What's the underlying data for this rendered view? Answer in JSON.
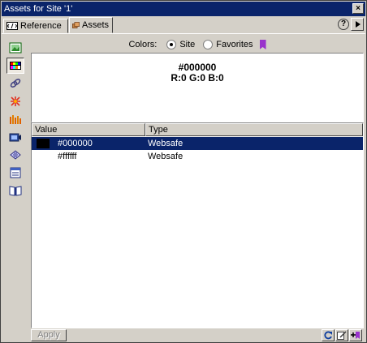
{
  "window": {
    "title": "Assets for Site '1'",
    "close_label": "×"
  },
  "tabs": [
    {
      "label": "Reference",
      "icon": "reference-icon"
    },
    {
      "label": "Assets",
      "icon": "assets-icon",
      "active": true
    }
  ],
  "header": {
    "help_label": "?"
  },
  "sidebar": {
    "items": [
      {
        "name": "images",
        "icon": "image-icon"
      },
      {
        "name": "colors",
        "icon": "color-swatch-icon",
        "selected": true
      },
      {
        "name": "urls",
        "icon": "link-icon"
      },
      {
        "name": "flash",
        "icon": "flash-icon"
      },
      {
        "name": "shockwave",
        "icon": "shockwave-icon"
      },
      {
        "name": "movies",
        "icon": "movie-icon"
      },
      {
        "name": "scripts",
        "icon": "script-icon"
      },
      {
        "name": "templates",
        "icon": "template-icon"
      },
      {
        "name": "library",
        "icon": "library-icon"
      }
    ]
  },
  "colors_filter": {
    "label": "Colors:",
    "options": [
      {
        "label": "Site",
        "selected": true
      },
      {
        "label": "Favorites",
        "selected": false
      }
    ]
  },
  "preview": {
    "hex": "#000000",
    "rgb": "R:0 G:0 B:0"
  },
  "list": {
    "columns": [
      "Value",
      "Type"
    ],
    "rows": [
      {
        "value": "#000000",
        "type": "Websafe",
        "swatch": "#000000",
        "selected": true
      },
      {
        "value": "#ffffff",
        "type": "Websafe",
        "swatch": "#ffffff",
        "selected": false
      }
    ]
  },
  "footer": {
    "apply_label": "Apply"
  },
  "colors": {
    "title_bar": "#0a246a",
    "selection": "#0a246a",
    "face": "#d4d0c8",
    "favorites_bookmark": "#9933cc"
  }
}
